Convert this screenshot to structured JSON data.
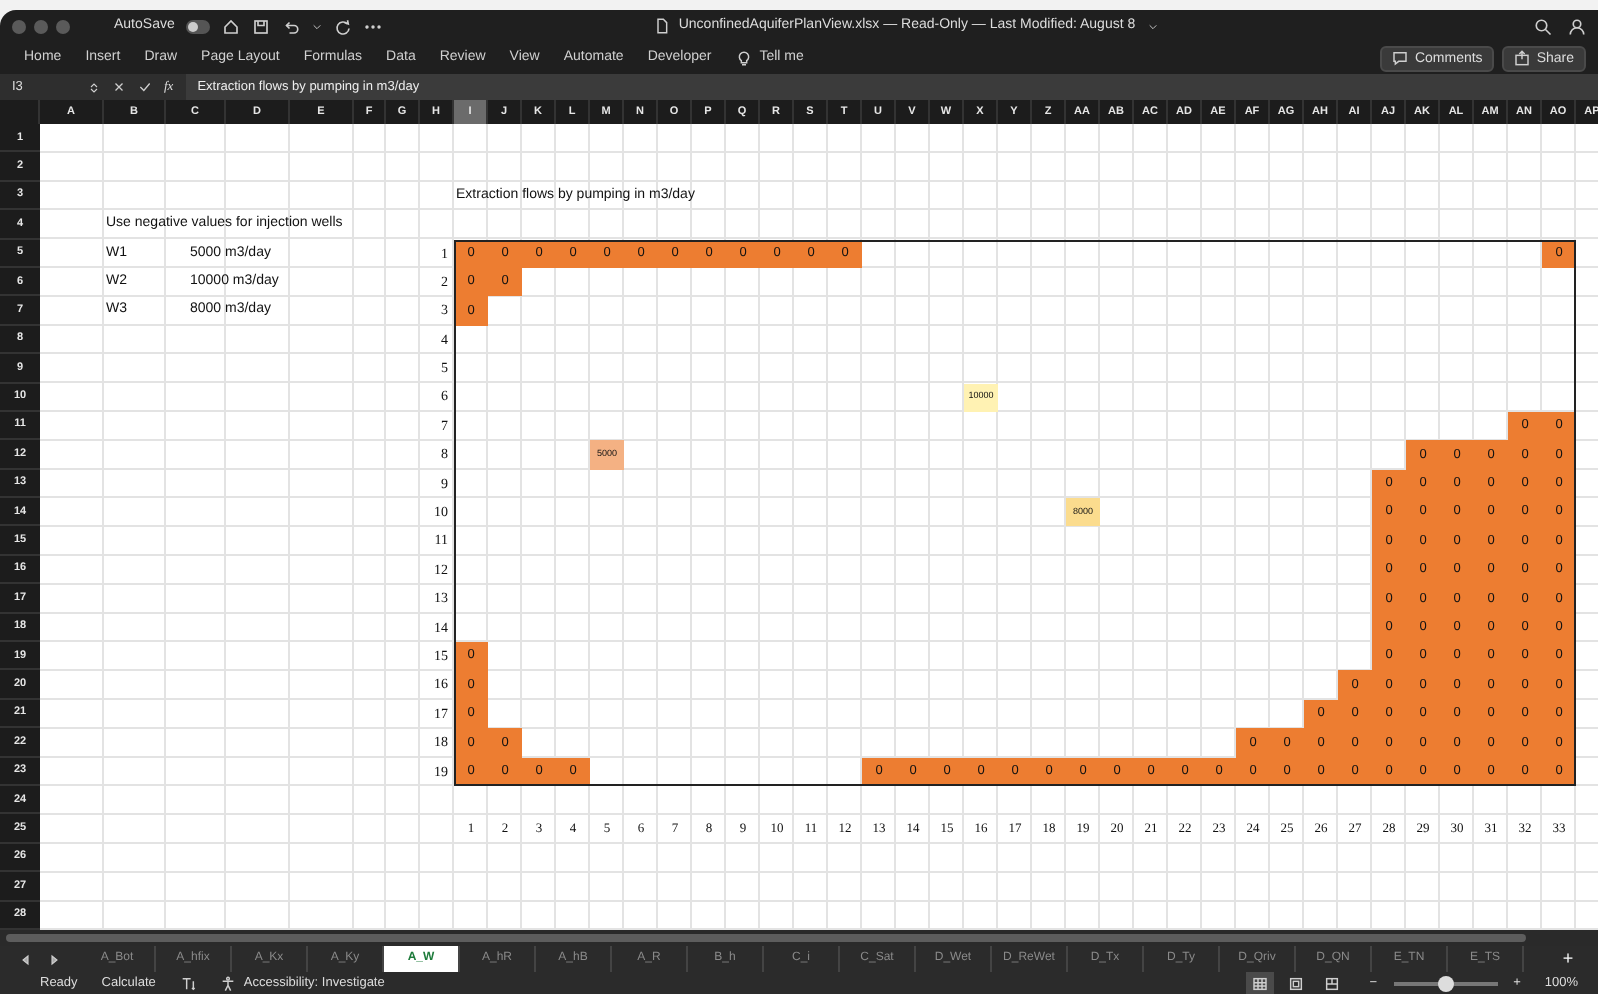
{
  "window": {
    "title": "UnconfinedAquiferPlanView.xlsx — Read-Only — Last Modified: August 8",
    "autosave": {
      "label": "AutoSave",
      "on": false
    }
  },
  "ribbon": {
    "tabs": [
      {
        "label": "Home",
        "selected": false
      },
      {
        "label": "Insert",
        "selected": false
      },
      {
        "label": "Draw",
        "selected": false
      },
      {
        "label": "Page Layout",
        "selected": false
      },
      {
        "label": "Formulas",
        "selected": false
      },
      {
        "label": "Data",
        "selected": false
      },
      {
        "label": "Review",
        "selected": false
      },
      {
        "label": "View",
        "selected": false
      },
      {
        "label": "Automate",
        "selected": false
      },
      {
        "label": "Developer",
        "selected": false
      }
    ],
    "tell_me": "Tell me",
    "buttons": [
      "Comments",
      "Share"
    ]
  },
  "formula_bar": {
    "name_box": "I3",
    "function_label": "fx",
    "formula": "Extraction flows by pumping in m3/day"
  },
  "sheet": {
    "columns": [
      {
        "label": "A",
        "selected": false
      },
      {
        "label": "B",
        "selected": false
      },
      {
        "label": "C",
        "selected": false
      },
      {
        "label": "D",
        "selected": false
      },
      {
        "label": "E",
        "selected": false
      },
      {
        "label": "F",
        "selected": false
      },
      {
        "label": "G",
        "selected": false
      },
      {
        "label": "H",
        "selected": false
      },
      {
        "label": "I",
        "selected": true
      },
      {
        "label": "J",
        "selected": false
      },
      {
        "label": "K",
        "selected": false
      },
      {
        "label": "L",
        "selected": false
      },
      {
        "label": "M",
        "selected": false
      },
      {
        "label": "N",
        "selected": false
      },
      {
        "label": "O",
        "selected": false
      },
      {
        "label": "P",
        "selected": false
      },
      {
        "label": "Q",
        "selected": false
      },
      {
        "label": "R",
        "selected": false
      },
      {
        "label": "S",
        "selected": false
      },
      {
        "label": "T",
        "selected": false
      },
      {
        "label": "U",
        "selected": false
      },
      {
        "label": "V",
        "selected": false
      },
      {
        "label": "W",
        "selected": false
      },
      {
        "label": "X",
        "selected": false
      },
      {
        "label": "Y",
        "selected": false
      },
      {
        "label": "Z",
        "selected": false
      },
      {
        "label": "AA",
        "selected": false
      },
      {
        "label": "AB",
        "selected": false
      },
      {
        "label": "AC",
        "selected": false
      },
      {
        "label": "AD",
        "selected": false
      },
      {
        "label": "AE",
        "selected": false
      },
      {
        "label": "AF",
        "selected": false
      },
      {
        "label": "AG",
        "selected": false
      },
      {
        "label": "AH",
        "selected": false
      },
      {
        "label": "AI",
        "selected": false
      },
      {
        "label": "AJ",
        "selected": false
      },
      {
        "label": "AK",
        "selected": false
      },
      {
        "label": "AL",
        "selected": false
      },
      {
        "label": "AM",
        "selected": false
      },
      {
        "label": "AN",
        "selected": false
      },
      {
        "label": "AO",
        "selected": false
      },
      {
        "label": "AP",
        "selected": false
      }
    ],
    "rows": [
      "1",
      "2",
      "3",
      "4",
      "5",
      "6",
      "7",
      "8",
      "9",
      "10",
      "11",
      "12",
      "13",
      "14",
      "15",
      "16",
      "17",
      "18",
      "19",
      "20",
      "21",
      "22",
      "23",
      "24",
      "25",
      "26",
      "27",
      "28"
    ],
    "instruction": "Use negative values for injection wells",
    "wells": [
      {
        "name": "W1",
        "rate": "5000 m3/day"
      },
      {
        "name": "W2",
        "rate": "10000 m3/day"
      },
      {
        "name": "W3",
        "rate": "8000 m3/day"
      }
    ],
    "model_title": "Extraction flows by pumping in m3/day"
  },
  "model": {
    "rows": [
      {
        "label": "1",
        "cells": [
          {
            "value": "0",
            "color": "#ed7d31"
          },
          {
            "value": "0",
            "color": "#ed7d31"
          },
          {
            "value": "0",
            "color": "#ed7d31"
          },
          {
            "value": "0",
            "color": "#ed7d31"
          },
          {
            "value": "0",
            "color": "#ed7d31"
          },
          {
            "value": "0",
            "color": "#ed7d31"
          },
          {
            "value": "0",
            "color": "#ed7d31"
          },
          {
            "value": "0",
            "color": "#ed7d31"
          },
          {
            "value": "0",
            "color": "#ed7d31"
          },
          {
            "value": "0",
            "color": "#ed7d31"
          },
          {
            "value": "0",
            "color": "#ed7d31"
          },
          {
            "value": "0",
            "color": "#ed7d31"
          },
          null,
          null,
          null,
          null,
          null,
          null,
          null,
          null,
          null,
          null,
          null,
          null,
          null,
          null,
          null,
          null,
          null,
          null,
          null,
          null,
          {
            "value": "0",
            "color": "#ed7d31"
          }
        ]
      },
      {
        "label": "2",
        "cells": [
          {
            "value": "0",
            "color": "#ed7d31"
          },
          {
            "value": "0",
            "color": "#ed7d31"
          },
          null,
          null,
          null,
          null,
          null,
          null,
          null,
          null,
          null,
          null,
          null,
          null,
          null,
          null,
          null,
          null,
          null,
          null,
          null,
          null,
          null,
          null,
          null,
          null,
          null,
          null,
          null,
          null,
          null,
          null,
          null
        ]
      },
      {
        "label": "3",
        "cells": [
          {
            "value": "0",
            "color": "#ed7d31"
          },
          null,
          null,
          null,
          null,
          null,
          null,
          null,
          null,
          null,
          null,
          null,
          null,
          null,
          null,
          null,
          null,
          null,
          null,
          null,
          null,
          null,
          null,
          null,
          null,
          null,
          null,
          null,
          null,
          null,
          null,
          null,
          null
        ]
      },
      {
        "label": "4",
        "cells": [
          null,
          null,
          null,
          null,
          null,
          null,
          null,
          null,
          null,
          null,
          null,
          null,
          null,
          null,
          null,
          null,
          null,
          null,
          null,
          null,
          null,
          null,
          null,
          null,
          null,
          null,
          null,
          null,
          null,
          null,
          null,
          null,
          null
        ]
      },
      {
        "label": "5",
        "cells": [
          null,
          null,
          null,
          null,
          null,
          null,
          null,
          null,
          null,
          null,
          null,
          null,
          null,
          null,
          null,
          null,
          null,
          null,
          null,
          null,
          null,
          null,
          null,
          null,
          null,
          null,
          null,
          null,
          null,
          null,
          null,
          null,
          null
        ]
      },
      {
        "label": "6",
        "cells": [
          null,
          null,
          null,
          null,
          null,
          null,
          null,
          null,
          null,
          null,
          null,
          null,
          null,
          null,
          null,
          {
            "value": "10000",
            "color": "#fff2b3"
          },
          null,
          null,
          null,
          null,
          null,
          null,
          null,
          null,
          null,
          null,
          null,
          null,
          null,
          null,
          null,
          null,
          null
        ]
      },
      {
        "label": "7",
        "cells": [
          null,
          null,
          null,
          null,
          null,
          null,
          null,
          null,
          null,
          null,
          null,
          null,
          null,
          null,
          null,
          null,
          null,
          null,
          null,
          null,
          null,
          null,
          null,
          null,
          null,
          null,
          null,
          null,
          null,
          null,
          null,
          {
            "value": "0",
            "color": "#ed7d31"
          },
          {
            "value": "0",
            "color": "#ed7d31"
          }
        ]
      },
      {
        "label": "8",
        "cells": [
          null,
          null,
          null,
          null,
          {
            "value": "5000",
            "color": "#f4b183"
          },
          null,
          null,
          null,
          null,
          null,
          null,
          null,
          null,
          null,
          null,
          null,
          null,
          null,
          null,
          null,
          null,
          null,
          null,
          null,
          null,
          null,
          null,
          null,
          {
            "value": "0",
            "color": "#ed7d31"
          },
          {
            "value": "0",
            "color": "#ed7d31"
          },
          {
            "value": "0",
            "color": "#ed7d31"
          },
          {
            "value": "0",
            "color": "#ed7d31"
          },
          {
            "value": "0",
            "color": "#ed7d31"
          }
        ]
      },
      {
        "label": "9",
        "cells": [
          null,
          null,
          null,
          null,
          null,
          null,
          null,
          null,
          null,
          null,
          null,
          null,
          null,
          null,
          null,
          null,
          null,
          null,
          null,
          null,
          null,
          null,
          null,
          null,
          null,
          null,
          null,
          {
            "value": "0",
            "color": "#ed7d31"
          },
          {
            "value": "0",
            "color": "#ed7d31"
          },
          {
            "value": "0",
            "color": "#ed7d31"
          },
          {
            "value": "0",
            "color": "#ed7d31"
          },
          {
            "value": "0",
            "color": "#ed7d31"
          },
          {
            "value": "0",
            "color": "#ed7d31"
          }
        ]
      },
      {
        "label": "10",
        "cells": [
          null,
          null,
          null,
          null,
          null,
          null,
          null,
          null,
          null,
          null,
          null,
          null,
          null,
          null,
          null,
          null,
          null,
          null,
          {
            "value": "8000",
            "color": "#fbdc8e"
          },
          null,
          null,
          null,
          null,
          null,
          null,
          null,
          null,
          {
            "value": "0",
            "color": "#ed7d31"
          },
          {
            "value": "0",
            "color": "#ed7d31"
          },
          {
            "value": "0",
            "color": "#ed7d31"
          },
          {
            "value": "0",
            "color": "#ed7d31"
          },
          {
            "value": "0",
            "color": "#ed7d31"
          },
          {
            "value": "0",
            "color": "#ed7d31"
          }
        ]
      },
      {
        "label": "11",
        "cells": [
          null,
          null,
          null,
          null,
          null,
          null,
          null,
          null,
          null,
          null,
          null,
          null,
          null,
          null,
          null,
          null,
          null,
          null,
          null,
          null,
          null,
          null,
          null,
          null,
          null,
          null,
          null,
          {
            "value": "0",
            "color": "#ed7d31"
          },
          {
            "value": "0",
            "color": "#ed7d31"
          },
          {
            "value": "0",
            "color": "#ed7d31"
          },
          {
            "value": "0",
            "color": "#ed7d31"
          },
          {
            "value": "0",
            "color": "#ed7d31"
          },
          {
            "value": "0",
            "color": "#ed7d31"
          }
        ]
      },
      {
        "label": "12",
        "cells": [
          null,
          null,
          null,
          null,
          null,
          null,
          null,
          null,
          null,
          null,
          null,
          null,
          null,
          null,
          null,
          null,
          null,
          null,
          null,
          null,
          null,
          null,
          null,
          null,
          null,
          null,
          null,
          {
            "value": "0",
            "color": "#ed7d31"
          },
          {
            "value": "0",
            "color": "#ed7d31"
          },
          {
            "value": "0",
            "color": "#ed7d31"
          },
          {
            "value": "0",
            "color": "#ed7d31"
          },
          {
            "value": "0",
            "color": "#ed7d31"
          },
          {
            "value": "0",
            "color": "#ed7d31"
          }
        ]
      },
      {
        "label": "13",
        "cells": [
          null,
          null,
          null,
          null,
          null,
          null,
          null,
          null,
          null,
          null,
          null,
          null,
          null,
          null,
          null,
          null,
          null,
          null,
          null,
          null,
          null,
          null,
          null,
          null,
          null,
          null,
          null,
          {
            "value": "0",
            "color": "#ed7d31"
          },
          {
            "value": "0",
            "color": "#ed7d31"
          },
          {
            "value": "0",
            "color": "#ed7d31"
          },
          {
            "value": "0",
            "color": "#ed7d31"
          },
          {
            "value": "0",
            "color": "#ed7d31"
          },
          {
            "value": "0",
            "color": "#ed7d31"
          }
        ]
      },
      {
        "label": "14",
        "cells": [
          null,
          null,
          null,
          null,
          null,
          null,
          null,
          null,
          null,
          null,
          null,
          null,
          null,
          null,
          null,
          null,
          null,
          null,
          null,
          null,
          null,
          null,
          null,
          null,
          null,
          null,
          null,
          {
            "value": "0",
            "color": "#ed7d31"
          },
          {
            "value": "0",
            "color": "#ed7d31"
          },
          {
            "value": "0",
            "color": "#ed7d31"
          },
          {
            "value": "0",
            "color": "#ed7d31"
          },
          {
            "value": "0",
            "color": "#ed7d31"
          },
          {
            "value": "0",
            "color": "#ed7d31"
          }
        ]
      },
      {
        "label": "15",
        "cells": [
          {
            "value": "0",
            "color": "#ed7d31"
          },
          null,
          null,
          null,
          null,
          null,
          null,
          null,
          null,
          null,
          null,
          null,
          null,
          null,
          null,
          null,
          null,
          null,
          null,
          null,
          null,
          null,
          null,
          null,
          null,
          null,
          null,
          {
            "value": "0",
            "color": "#ed7d31"
          },
          {
            "value": "0",
            "color": "#ed7d31"
          },
          {
            "value": "0",
            "color": "#ed7d31"
          },
          {
            "value": "0",
            "color": "#ed7d31"
          },
          {
            "value": "0",
            "color": "#ed7d31"
          },
          {
            "value": "0",
            "color": "#ed7d31"
          }
        ]
      },
      {
        "label": "16",
        "cells": [
          {
            "value": "0",
            "color": "#ed7d31"
          },
          null,
          null,
          null,
          null,
          null,
          null,
          null,
          null,
          null,
          null,
          null,
          null,
          null,
          null,
          null,
          null,
          null,
          null,
          null,
          null,
          null,
          null,
          null,
          null,
          null,
          {
            "value": "0",
            "color": "#ed7d31"
          },
          {
            "value": "0",
            "color": "#ed7d31"
          },
          {
            "value": "0",
            "color": "#ed7d31"
          },
          {
            "value": "0",
            "color": "#ed7d31"
          },
          {
            "value": "0",
            "color": "#ed7d31"
          },
          {
            "value": "0",
            "color": "#ed7d31"
          },
          {
            "value": "0",
            "color": "#ed7d31"
          }
        ]
      },
      {
        "label": "17",
        "cells": [
          {
            "value": "0",
            "color": "#ed7d31"
          },
          null,
          null,
          null,
          null,
          null,
          null,
          null,
          null,
          null,
          null,
          null,
          null,
          null,
          null,
          null,
          null,
          null,
          null,
          null,
          null,
          null,
          null,
          null,
          null,
          {
            "value": "0",
            "color": "#ed7d31"
          },
          {
            "value": "0",
            "color": "#ed7d31"
          },
          {
            "value": "0",
            "color": "#ed7d31"
          },
          {
            "value": "0",
            "color": "#ed7d31"
          },
          {
            "value": "0",
            "color": "#ed7d31"
          },
          {
            "value": "0",
            "color": "#ed7d31"
          },
          {
            "value": "0",
            "color": "#ed7d31"
          },
          {
            "value": "0",
            "color": "#ed7d31"
          }
        ]
      },
      {
        "label": "18",
        "cells": [
          {
            "value": "0",
            "color": "#ed7d31"
          },
          {
            "value": "0",
            "color": "#ed7d31"
          },
          null,
          null,
          null,
          null,
          null,
          null,
          null,
          null,
          null,
          null,
          null,
          null,
          null,
          null,
          null,
          null,
          null,
          null,
          null,
          null,
          null,
          {
            "value": "0",
            "color": "#ed7d31"
          },
          {
            "value": "0",
            "color": "#ed7d31"
          },
          {
            "value": "0",
            "color": "#ed7d31"
          },
          {
            "value": "0",
            "color": "#ed7d31"
          },
          {
            "value": "0",
            "color": "#ed7d31"
          },
          {
            "value": "0",
            "color": "#ed7d31"
          },
          {
            "value": "0",
            "color": "#ed7d31"
          },
          {
            "value": "0",
            "color": "#ed7d31"
          },
          {
            "value": "0",
            "color": "#ed7d31"
          },
          {
            "value": "0",
            "color": "#ed7d31"
          }
        ]
      },
      {
        "label": "19",
        "cells": [
          {
            "value": "0",
            "color": "#ed7d31"
          },
          {
            "value": "0",
            "color": "#ed7d31"
          },
          {
            "value": "0",
            "color": "#ed7d31"
          },
          {
            "value": "0",
            "color": "#ed7d31"
          },
          null,
          null,
          null,
          null,
          null,
          null,
          null,
          null,
          {
            "value": "0",
            "color": "#ed7d31"
          },
          {
            "value": "0",
            "color": "#ed7d31"
          },
          {
            "value": "0",
            "color": "#ed7d31"
          },
          {
            "value": "0",
            "color": "#ed7d31"
          },
          {
            "value": "0",
            "color": "#ed7d31"
          },
          {
            "value": "0",
            "color": "#ed7d31"
          },
          {
            "value": "0",
            "color": "#ed7d31"
          },
          {
            "value": "0",
            "color": "#ed7d31"
          },
          {
            "value": "0",
            "color": "#ed7d31"
          },
          {
            "value": "0",
            "color": "#ed7d31"
          },
          {
            "value": "0",
            "color": "#ed7d31"
          },
          {
            "value": "0",
            "color": "#ed7d31"
          },
          {
            "value": "0",
            "color": "#ed7d31"
          },
          {
            "value": "0",
            "color": "#ed7d31"
          },
          {
            "value": "0",
            "color": "#ed7d31"
          },
          {
            "value": "0",
            "color": "#ed7d31"
          },
          {
            "value": "0",
            "color": "#ed7d31"
          },
          {
            "value": "0",
            "color": "#ed7d31"
          },
          {
            "value": "0",
            "color": "#ed7d31"
          },
          {
            "value": "0",
            "color": "#ed7d31"
          },
          {
            "value": "0",
            "color": "#ed7d31"
          }
        ]
      }
    ],
    "column_labels": [
      "1",
      "2",
      "3",
      "4",
      "5",
      "6",
      "7",
      "8",
      "9",
      "10",
      "11",
      "12",
      "13",
      "14",
      "15",
      "16",
      "17",
      "18",
      "19",
      "20",
      "21",
      "22",
      "23",
      "24",
      "25",
      "26",
      "27",
      "28",
      "29",
      "30",
      "31",
      "32",
      "33"
    ]
  },
  "sheet_tabs": {
    "tabs": [
      {
        "label": "A_Bot",
        "selected": false
      },
      {
        "label": "A_hfix",
        "selected": false
      },
      {
        "label": "A_Kx",
        "selected": false
      },
      {
        "label": "A_Ky",
        "selected": false
      },
      {
        "label": "A_W",
        "selected": true
      },
      {
        "label": "A_hR",
        "selected": false
      },
      {
        "label": "A_hB",
        "selected": false
      },
      {
        "label": "A_R",
        "selected": false
      },
      {
        "label": "B_h",
        "selected": false
      },
      {
        "label": "C_i",
        "selected": false
      },
      {
        "label": "C_Sat",
        "selected": false
      },
      {
        "label": "D_Wet",
        "selected": false
      },
      {
        "label": "D_ReWet",
        "selected": false
      },
      {
        "label": "D_Tx",
        "selected": false
      },
      {
        "label": "D_Ty",
        "selected": false
      },
      {
        "label": "D_Qriv",
        "selected": false
      },
      {
        "label": "D_QN",
        "selected": false
      },
      {
        "label": "E_TN",
        "selected": false
      },
      {
        "label": "E_TS",
        "selected": false
      }
    ],
    "add": "+"
  },
  "status_bar": {
    "mode": "Ready",
    "calculate": "Calculate",
    "accessibility": "Accessibility: Investigate",
    "views": [
      {
        "kind": "normal",
        "selected": true
      },
      {
        "kind": "page-layout",
        "selected": false
      },
      {
        "kind": "page-break",
        "selected": false
      }
    ],
    "zoom_out": "−",
    "zoom_in": "+",
    "zoom": {
      "level": 0.5
    },
    "zoom_reading": "100%"
  }
}
